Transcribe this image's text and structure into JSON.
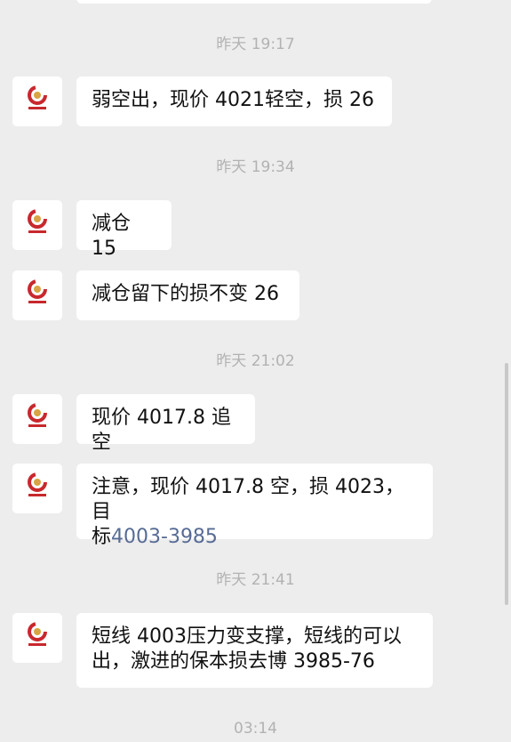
{
  "colors": {
    "background": "#ededed",
    "bubble": "#ffffff",
    "text": "#111111",
    "timestamp": "#b2b2b2",
    "link": "#576b95",
    "avatar_logo_red": "#c8282d",
    "avatar_logo_gold": "#d9a441"
  },
  "avatar": {
    "icon": "chuangxin-group-logo-icon"
  },
  "chat": {
    "time_1": "昨天 19:17",
    "msg_1": "弱空出，现价 4021轻空，损 26",
    "time_2": "昨天 19:34",
    "msg_2": "减仓 15",
    "msg_3": "减仓留下的损不变 26",
    "time_3": "昨天 21:02",
    "msg_4": "现价 4017.8 追空",
    "msg_5_line1": "注意，现价 4017.8 空，损 4023，目",
    "msg_5_line2_prefix": "标",
    "msg_5_link": "4003-3985",
    "time_4": "昨天 21:41",
    "msg_6_line1": "短线 4003压力变支撑，短线的可以",
    "msg_6_line2": "出，激进的保本损去博 3985-76",
    "time_5": "03:14"
  }
}
